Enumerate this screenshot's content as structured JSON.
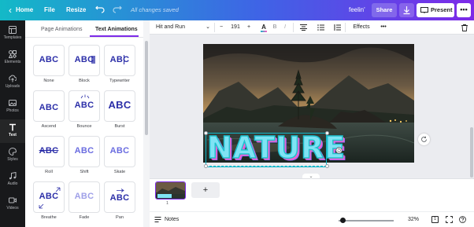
{
  "topbar": {
    "home_label": "Home",
    "file_label": "File",
    "resize_label": "Resize",
    "saved_status": "All changes saved",
    "design_title": "feelin'",
    "share_label": "Share",
    "present_label": "Present",
    "more_label": "•••"
  },
  "sidebar": {
    "items": [
      {
        "label": "Templates",
        "icon": "templates-icon"
      },
      {
        "label": "Elements",
        "icon": "elements-icon"
      },
      {
        "label": "Uploads",
        "icon": "uploads-icon"
      },
      {
        "label": "Photos",
        "icon": "photos-icon"
      },
      {
        "label": "Text",
        "icon": "text-icon"
      },
      {
        "label": "Styles",
        "icon": "styles-icon"
      },
      {
        "label": "Audio",
        "icon": "audio-icon"
      },
      {
        "label": "Videos",
        "icon": "videos-icon"
      }
    ],
    "active": "Text"
  },
  "panel": {
    "tabs": [
      "Page Animations",
      "Text Animations"
    ],
    "active_tab": "Text Animations",
    "animations": [
      {
        "name": "None",
        "sample": "ABC"
      },
      {
        "name": "Block",
        "sample": "ABC"
      },
      {
        "name": "Typewriter",
        "sample": "ABC"
      },
      {
        "name": "Ascend",
        "sample": "ABC"
      },
      {
        "name": "Bounce",
        "sample": "ABC"
      },
      {
        "name": "Burst",
        "sample": "ABC"
      },
      {
        "name": "Roll",
        "sample": "ABC"
      },
      {
        "name": "Shift",
        "sample": "ABC"
      },
      {
        "name": "Skate",
        "sample": "ABC"
      },
      {
        "name": "Breathe",
        "sample": "ABC"
      },
      {
        "name": "Fade",
        "sample": "ABC"
      },
      {
        "name": "Pan",
        "sample": "ABC"
      }
    ]
  },
  "toolbar": {
    "font_name": "Hit and Run",
    "font_size": "191",
    "minus": "−",
    "plus": "+",
    "bold": "B",
    "italic": "I",
    "effects_label": "Effects",
    "more": "•••",
    "color_letter": "A"
  },
  "canvas": {
    "text": "NATURE",
    "accent": "#12b7c8",
    "brand": "#7d2ae8"
  },
  "pages": {
    "thumb_number": "1",
    "add_label": "+"
  },
  "bottombar": {
    "notes_label": "Notes",
    "zoom": "32%",
    "page_count": "1",
    "zoom_fraction": 0.08
  }
}
